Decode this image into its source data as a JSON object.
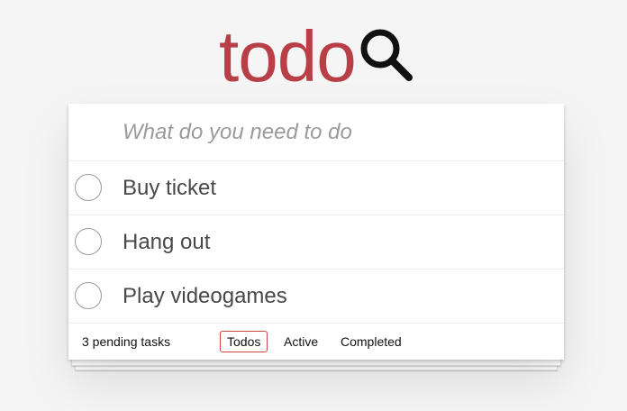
{
  "header": {
    "title": "todo",
    "search_icon": "search-icon"
  },
  "new_todo": {
    "placeholder": "What do you need to do",
    "value": ""
  },
  "todos": [
    {
      "label": "Buy ticket",
      "completed": false
    },
    {
      "label": "Hang out",
      "completed": false
    },
    {
      "label": "Play videogames",
      "completed": false
    }
  ],
  "footer": {
    "pending_text": "3 pending tasks",
    "filters": [
      {
        "label": "Todos",
        "selected": true
      },
      {
        "label": "Active",
        "selected": false
      },
      {
        "label": "Completed",
        "selected": false
      }
    ]
  },
  "colors": {
    "brand": "#b83f45",
    "selected_filter_border": "#ce4646",
    "background": "#f5f5f5"
  }
}
